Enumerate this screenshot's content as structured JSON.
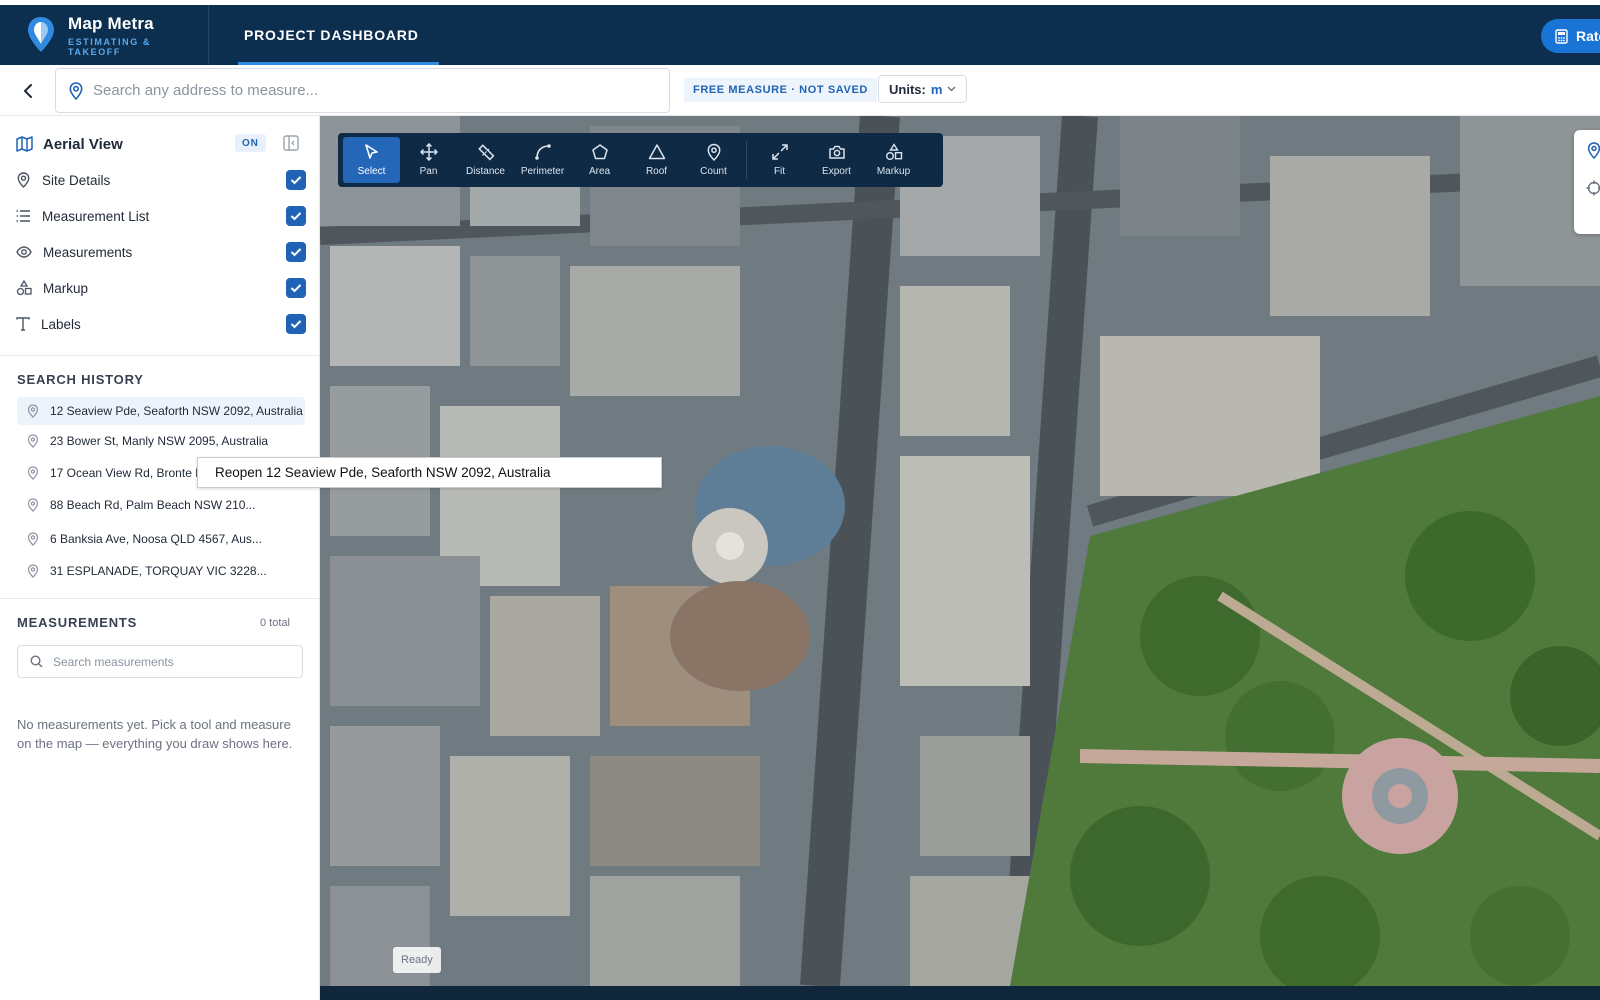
{
  "header": {
    "app_name": "Map Metra",
    "app_tagline": "ESTIMATING & TAKEOFF",
    "nav_tab": "PROJECT DASHBOARD",
    "right_button": "Rate"
  },
  "search": {
    "placeholder": "Search any address to measure...",
    "status_badge": "FREE MEASURE · NOT SAVED",
    "units_label": "Units:",
    "units_value": "m"
  },
  "layers": {
    "title": "Aerial View",
    "toggle_state": "ON",
    "items": [
      {
        "label": "Site Details",
        "icon": "map-pin-icon",
        "checked": true
      },
      {
        "label": "Measurement List",
        "icon": "list-icon",
        "checked": true
      },
      {
        "label": "Measurements",
        "icon": "eye-icon",
        "checked": true
      },
      {
        "label": "Markup",
        "icon": "shapes-icon",
        "checked": true
      },
      {
        "label": "Labels",
        "icon": "text-icon",
        "checked": true
      }
    ]
  },
  "history": {
    "title": "SEARCH HISTORY",
    "items": [
      "12 Seaview Pde, Seaforth NSW 2092, Australia",
      "23 Bower St, Manly NSW 2095, Australia",
      "17 Ocean View Rd, Bronte NSW 20...",
      "88 Beach Rd, Palm Beach NSW 210...",
      "6 Banksia Ave, Noosa QLD 4567, Aus...",
      "31 ESPLANADE, TORQUAY VIC 3228..."
    ]
  },
  "tooltip": "Reopen 12 Seaview Pde, Seaforth NSW 2092, Australia",
  "measurements": {
    "title": "MEASUREMENTS",
    "total": "0 total",
    "search_placeholder": "Search measurements",
    "empty_message": "No measurements yet. Pick a tool and measure on the map — everything you draw shows here."
  },
  "toolbar": {
    "tools": [
      {
        "label": "Select",
        "icon": "cursor-icon",
        "active": true
      },
      {
        "label": "Pan",
        "icon": "move-icon",
        "active": false
      },
      {
        "label": "Distance",
        "icon": "ruler-icon",
        "active": false
      },
      {
        "label": "Perimeter",
        "icon": "curve-icon",
        "active": false
      },
      {
        "label": "Area",
        "icon": "pentagon-icon",
        "active": false
      },
      {
        "label": "Roof",
        "icon": "triangle-icon",
        "active": false
      },
      {
        "label": "Count",
        "icon": "pin-icon",
        "active": false
      },
      {
        "label": "Fit",
        "icon": "expand-icon",
        "active": false
      },
      {
        "label": "Export",
        "icon": "camera-icon",
        "active": false
      },
      {
        "label": "Markup",
        "icon": "shapes-icon",
        "active": false
      }
    ]
  },
  "map": {
    "status": "Ready"
  },
  "colors": {
    "header_bg": "#0d2f4f",
    "accent": "#1e63b5",
    "toolbar_bg": "#0f2a44"
  }
}
